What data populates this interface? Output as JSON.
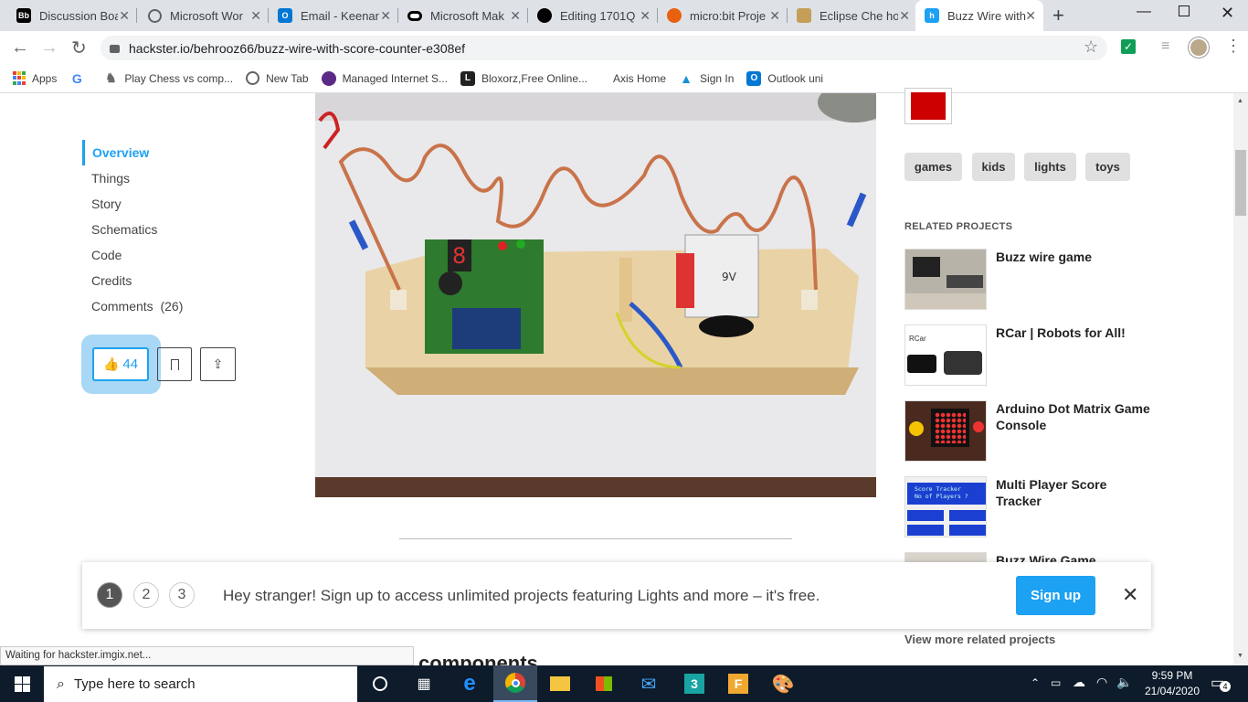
{
  "tabs": [
    {
      "label": "Discussion Boa",
      "icon": "Bb",
      "color": "#000000"
    },
    {
      "label": "Microsoft Wor",
      "icon": "globe",
      "color": "#5f6368"
    },
    {
      "label": "Email - Keenan",
      "icon": "O",
      "color": "#0078d4"
    },
    {
      "label": "Microsoft Mak",
      "icon": "mm",
      "color": "#000000"
    },
    {
      "label": "Editing 1701Q",
      "icon": "gh",
      "color": "#000000"
    },
    {
      "label": "micro:bit Proje",
      "icon": "mb",
      "color": "#e8610f"
    },
    {
      "label": "Eclipse Che ho",
      "icon": "ec",
      "color": "#c59f57"
    },
    {
      "label": "Buzz Wire with",
      "icon": "hs",
      "color": "#1da1f2",
      "active": true
    }
  ],
  "address": {
    "url": "hackster.io/behrooz66/buzz-wire-with-score-counter-e308ef"
  },
  "bookmarks": [
    {
      "label": "Apps",
      "icon": "apps-grid"
    },
    {
      "label": "",
      "icon": "G"
    },
    {
      "label": "Play Chess vs comp...",
      "icon": "chess"
    },
    {
      "label": "New Tab",
      "icon": "globe"
    },
    {
      "label": "Managed Internet S...",
      "icon": "mi"
    },
    {
      "label": "Bloxorz,Free Online...",
      "icon": "L"
    },
    {
      "label": "Axis Home",
      "icon": ""
    },
    {
      "label": "Sign In",
      "icon": "A"
    },
    {
      "label": "Outlook uni",
      "icon": "O"
    }
  ],
  "nav": {
    "items": [
      "Overview",
      "Things",
      "Story",
      "Schematics",
      "Code",
      "Credits",
      "Comments"
    ],
    "comments_count": "(26)",
    "likes": "44"
  },
  "tags": [
    "games",
    "kids",
    "lights",
    "toys"
  ],
  "related": {
    "heading": "RELATED PROJECTS",
    "items": [
      "Buzz wire game",
      "RCar | Robots for All!",
      "Arduino Dot Matrix Game Console",
      "Multi Player Score Tracker",
      "Buzz Wire Game"
    ],
    "rcar_label": "RCar",
    "tracker_lines": [
      "Score Tracker",
      "No of Players ?"
    ],
    "view_more": "View more related projects"
  },
  "photo": {
    "battery_label": "9V"
  },
  "signup": {
    "steps": [
      "1",
      "2",
      "3"
    ],
    "message": "Hey stranger! Sign up to access unlimited projects featuring Lights and more – it's free.",
    "button": "Sign up"
  },
  "next_heading": "components",
  "status_bar": "Waiting for hackster.imgix.net...",
  "taskbar": {
    "search_placeholder": "Type here to search",
    "time": "9:59 PM",
    "date": "21/04/2020",
    "notifications": "4"
  },
  "colors": {
    "accent": "#1da1f2",
    "signup": "#1da1f2",
    "taskbar": "#0d1b2a"
  }
}
